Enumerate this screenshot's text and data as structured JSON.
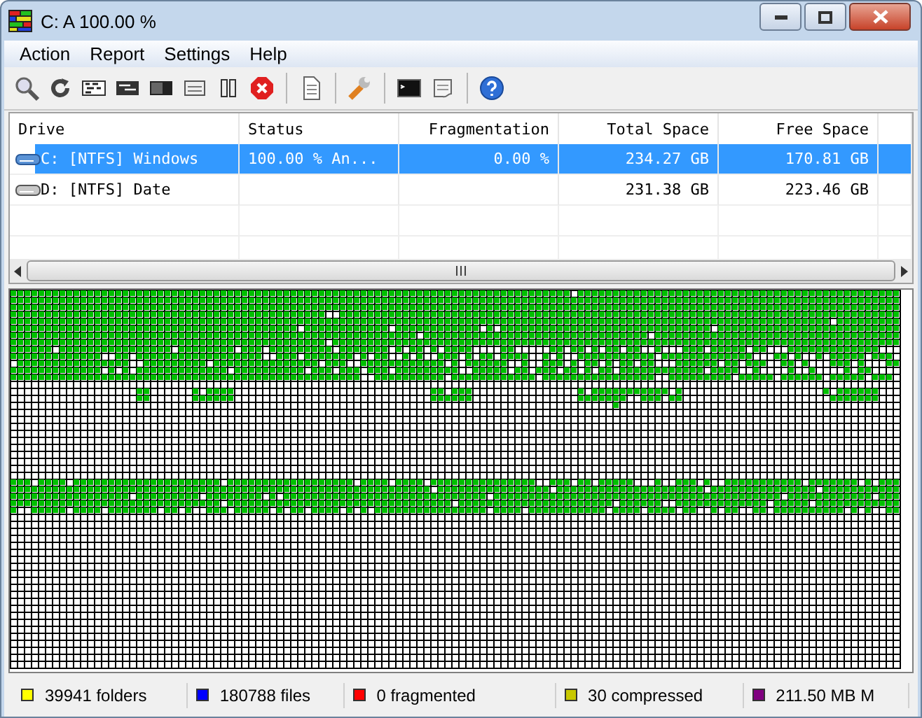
{
  "window": {
    "title": "C:  A 100.00 %"
  },
  "menu": [
    "Action",
    "Report",
    "Settings",
    "Help"
  ],
  "table": {
    "columns": [
      "Drive",
      "Status",
      "Fragmentation",
      "Total Space",
      "Free Space"
    ],
    "rows": [
      {
        "kind": "system",
        "drive": "C: [NTFS]  Windows",
        "status": "100.00 % An...",
        "fragmentation": "0.00 %",
        "total": "234.27 GB",
        "free": "170.81 GB",
        "selected": true
      },
      {
        "kind": "data",
        "drive": "D: [NTFS]  Date",
        "status": "",
        "fragmentation": "",
        "total": "231.38 GB",
        "free": "223.46 GB",
        "selected": false
      }
    ]
  },
  "status_bar": [
    {
      "text": "39941 folders",
      "color": "#ffff00"
    },
    {
      "text": "180788 files",
      "color": "#0000ff"
    },
    {
      "text": "0 fragmented",
      "color": "#ff0000"
    },
    {
      "text": "30 compressed",
      "color": "#c8c800"
    },
    {
      "text": "211.50 MB M",
      "color": "#800080"
    }
  ]
}
